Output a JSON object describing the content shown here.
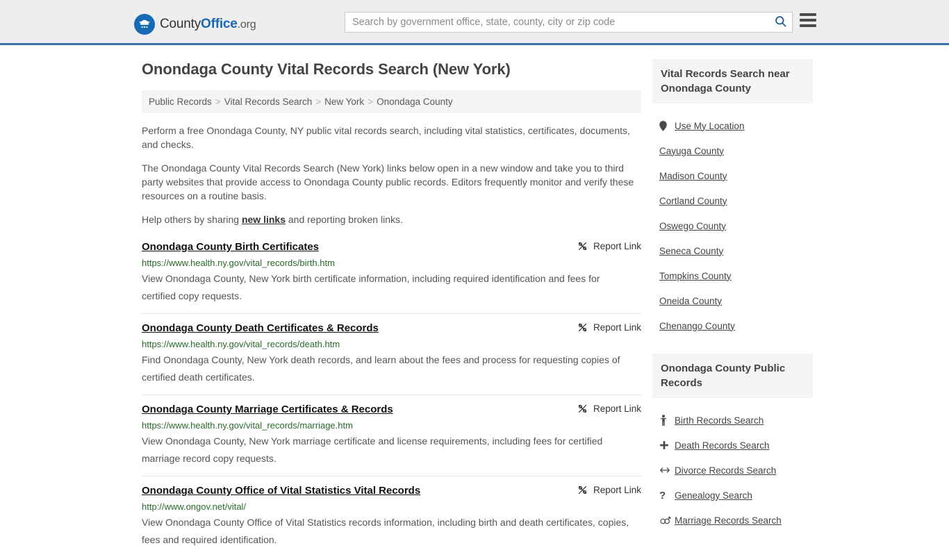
{
  "header": {
    "logo": {
      "icon": "eagle-shield-icon",
      "text_part1": "County",
      "text_part2": "Office",
      "text_part3": ".org"
    },
    "search": {
      "placeholder": "Search by government office, state, county, city or zip code",
      "value": "",
      "search_icon": "search-icon"
    },
    "menu_icon": "hamburger-menu-icon",
    "accent_color": "#3a6fa8",
    "background_color": "#eeeeee"
  },
  "main": {
    "title": "Onondaga County Vital Records Search (New York)",
    "breadcrumb": [
      {
        "label": "Public Records"
      },
      {
        "label": "Vital Records Search"
      },
      {
        "label": "New York"
      },
      {
        "label": "Onondaga County"
      }
    ],
    "breadcrumb_separator": ">",
    "intro": {
      "p1": "Perform a free Onondaga County, NY public vital records search, including vital statistics, certificates, documents, and checks.",
      "p2": "The Onondaga County Vital Records Search (New York) links below open in a new window and take you to third party websites that provide access to Onondaga County public records. Editors frequently monitor and verify these resources on a routine basis.",
      "p3_before": "Help others by sharing ",
      "p3_link": "new links",
      "p3_after": " and reporting broken links."
    },
    "report_link_label": "Report Link",
    "report_link_icon": "broken-link-icon",
    "url_color": "#2a6a2a",
    "results": [
      {
        "title": "Onondaga County Birth Certificates",
        "url": "https://www.health.ny.gov/vital_records/birth.htm",
        "description": "View Onondaga County, New York birth certificate information, including required identification and fees for certified copy requests."
      },
      {
        "title": "Onondaga County Death Certificates & Records",
        "url": "https://www.health.ny.gov/vital_records/death.htm",
        "description": "Find Onondaga County, New York death records, and learn about the fees and process for requesting copies of certified death certificates."
      },
      {
        "title": "Onondaga County Marriage Certificates & Records",
        "url": "https://www.health.ny.gov/vital_records/marriage.htm",
        "description": "View Onondaga County, New York marriage certificate and license requirements, including fees for certified marriage record copy requests."
      },
      {
        "title": "Onondaga County Office of Vital Statistics Vital Records",
        "url": "http://www.ongov.net/vital/",
        "description": "View Onondaga County Office of Vital Statistics records information, including birth and death certificates, copies, fees and required identification."
      }
    ]
  },
  "sidebar": {
    "panels": [
      {
        "title": "Vital Records Search near Onondaga County",
        "items": [
          {
            "label": "Use My Location",
            "icon": "map-pin-icon"
          },
          {
            "label": "Cayuga County",
            "icon": ""
          },
          {
            "label": "Madison County",
            "icon": ""
          },
          {
            "label": "Cortland County",
            "icon": ""
          },
          {
            "label": "Oswego County",
            "icon": ""
          },
          {
            "label": "Seneca County",
            "icon": ""
          },
          {
            "label": "Tompkins County",
            "icon": ""
          },
          {
            "label": "Oneida County",
            "icon": ""
          },
          {
            "label": "Chenango County",
            "icon": ""
          }
        ]
      },
      {
        "title": "Onondaga County Public Records",
        "items": [
          {
            "label": "Birth Records Search",
            "icon": "baby-icon"
          },
          {
            "label": "Death Records Search",
            "icon": "cross-icon"
          },
          {
            "label": "Divorce Records Search",
            "icon": "left-right-arrow-icon"
          },
          {
            "label": "Genealogy Search",
            "icon": "question-mark-icon"
          },
          {
            "label": "Marriage Records Search",
            "icon": "male-female-icon"
          }
        ]
      }
    ]
  }
}
